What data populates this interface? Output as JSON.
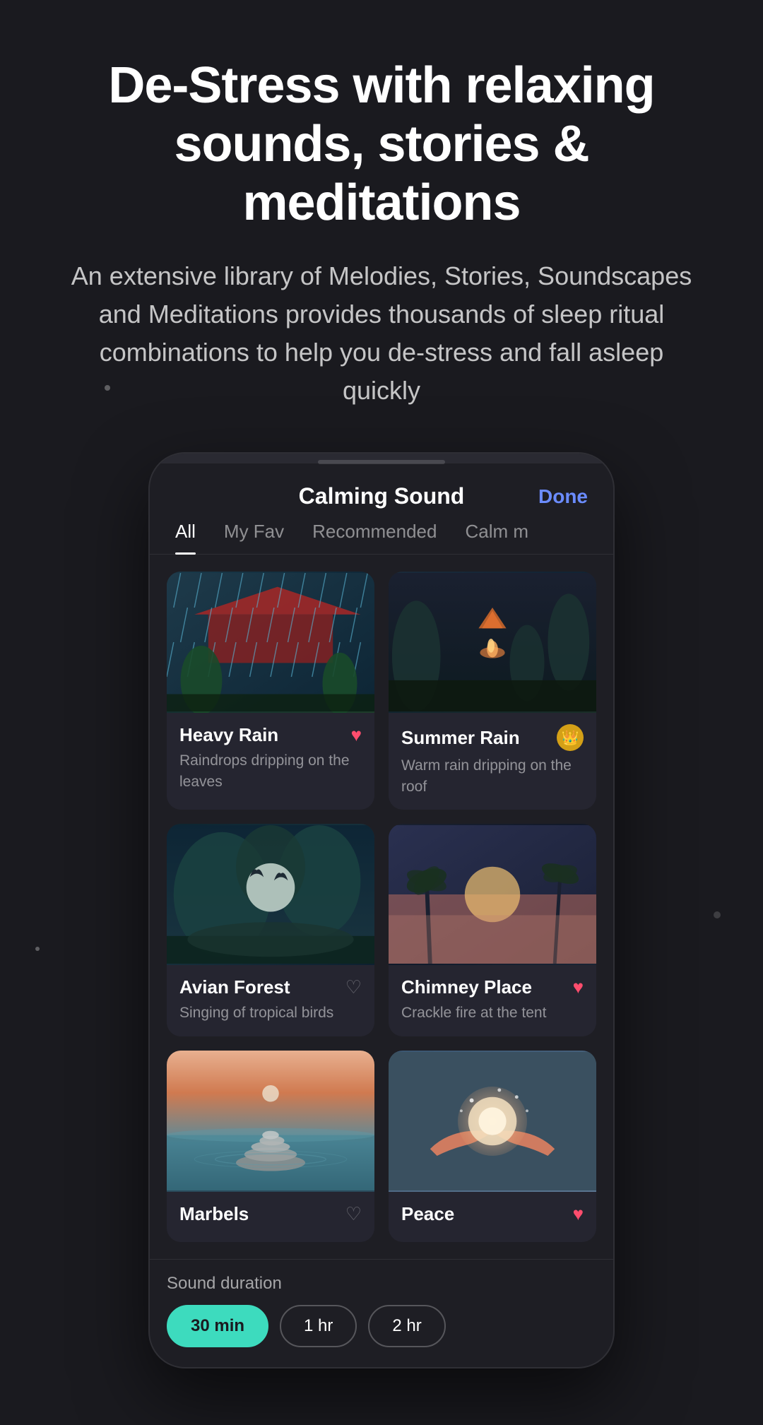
{
  "header": {
    "main_title": "De-Stress with relaxing sounds, stories & meditations",
    "subtitle": "An extensive library of Melodies, Stories, Soundscapes and Meditations provides thousands of sleep ritual combinations to help you de-stress and fall asleep quickly"
  },
  "app": {
    "title": "Calming Sound",
    "done_label": "Done",
    "tabs": [
      {
        "id": "all",
        "label": "All",
        "active": true
      },
      {
        "id": "myfav",
        "label": "My Fav",
        "active": false
      },
      {
        "id": "recommended",
        "label": "Recommended",
        "active": false
      },
      {
        "id": "calmm",
        "label": "Calm m",
        "active": false
      }
    ],
    "sounds": [
      {
        "id": "heavy-rain",
        "name": "Heavy Rain",
        "description": "Raindrops dripping on the leaves",
        "liked": true,
        "premium": false
      },
      {
        "id": "summer-rain",
        "name": "Summer Rain",
        "description": "Warm rain dripping on the roof",
        "liked": false,
        "premium": true
      },
      {
        "id": "avian-forest",
        "name": "Avian Forest",
        "description": "Singing of tropical birds",
        "liked": false,
        "premium": false
      },
      {
        "id": "chimney-place",
        "name": "Chimney Place",
        "description": "Crackle fire at the tent",
        "liked": true,
        "premium": false
      },
      {
        "id": "marbels",
        "name": "Marbels",
        "description": "",
        "liked": false,
        "premium": false
      },
      {
        "id": "peace",
        "name": "Peace",
        "description": "",
        "liked": true,
        "premium": false
      }
    ],
    "duration": {
      "label": "Sound duration",
      "options": [
        {
          "id": "30min",
          "label": "30 min",
          "active": true
        },
        {
          "id": "1hr",
          "label": "1 hr",
          "active": false
        },
        {
          "id": "2hr",
          "label": "2 hr",
          "active": false
        }
      ]
    }
  }
}
